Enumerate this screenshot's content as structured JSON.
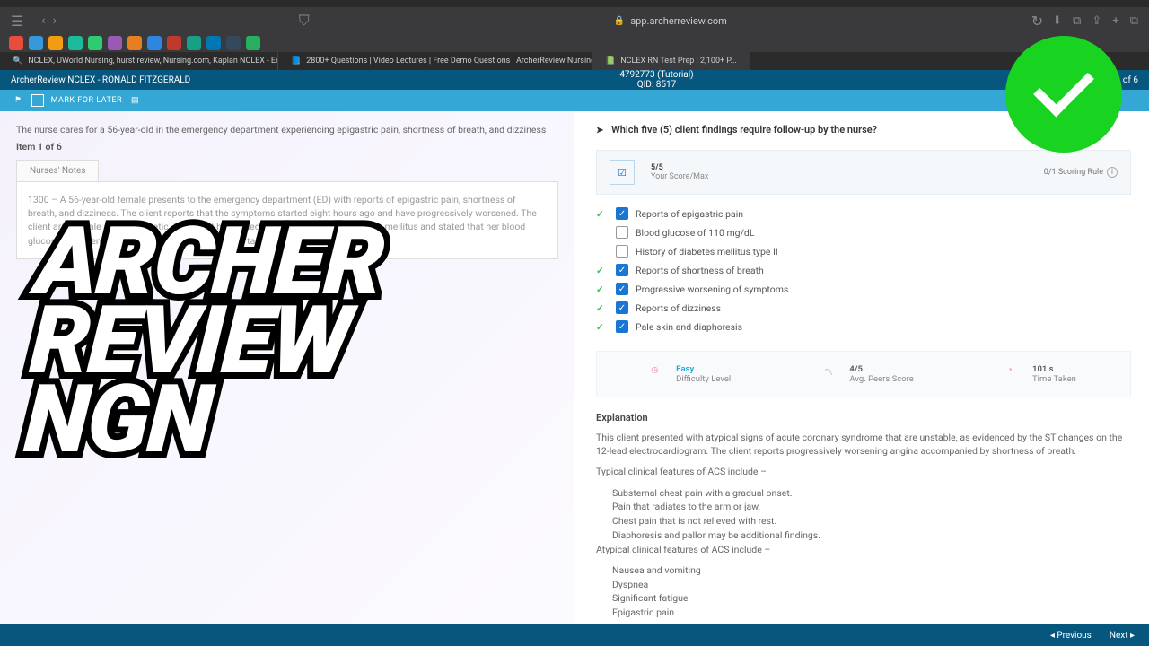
{
  "browser": {
    "url": "app.archerreview.com",
    "tabs": [
      "NCLEX, UWorld Nursing, hurst review, Nursing.com, Kaplan NCLEX - Explore - Go...",
      "2800+ Questions | Video Lectures | Free Demo Questions | ArcherReview Nursing",
      "NCLEX RN Test Prep | 2,100+ P..."
    ]
  },
  "app": {
    "title_left": "ArcherReview NCLEX - RONALD FITZGERALD",
    "title_center_top": "4792773 (Tutorial)",
    "title_center_bottom": "QID: 8517",
    "title_right": "of 6",
    "toolbar_label": "MARK FOR LATER"
  },
  "question": {
    "stem": "The nurse cares for a 56-year-old in the emergency department experiencing epigastric pain, shortness of breath, and dizziness",
    "item_count": "Item 1 of 6",
    "notes_tab": "Nurses' Notes",
    "notes_body": "1300 – A 56-year-old female presents to the emergency department (ED) with reports of epigastric pain, shortness of breath, and dizziness. The client reports that the symptoms started eight hours ago and have progressively worsened. The client arrives pale and diaphoretic. The client has a medical history of type II diabetes mellitus and stated that her blood glucose has been 'very high.' The blood glucose was taken, and it was 110 mg/dL.",
    "prompt": "Which five (5) client findings require follow-up by the nurse?"
  },
  "score": {
    "top": "5/5",
    "bottom": "Your Score/Max",
    "rule": "0/1 Scoring Rule"
  },
  "options": [
    {
      "correct": true,
      "checked": true,
      "label": "Reports of epigastric pain"
    },
    {
      "correct": false,
      "checked": false,
      "label": "Blood glucose of 110 mg/dL"
    },
    {
      "correct": false,
      "checked": false,
      "label": "History of diabetes mellitus type II"
    },
    {
      "correct": true,
      "checked": true,
      "label": "Reports of shortness of breath"
    },
    {
      "correct": true,
      "checked": true,
      "label": "Progressive worsening of symptoms"
    },
    {
      "correct": true,
      "checked": true,
      "label": "Reports of dizziness"
    },
    {
      "correct": true,
      "checked": true,
      "label": "Pale skin and diaphoresis"
    }
  ],
  "stats": {
    "difficulty_value": "Easy",
    "difficulty_label": "Difficulty Level",
    "peers_value": "4/5",
    "peers_label": "Avg. Peers Score",
    "time_value": "101 s",
    "time_label": "Time Taken"
  },
  "explanation": {
    "heading": "Explanation",
    "p1": "This client presented with atypical signs of acute coronary syndrome that are unstable, as evidenced by the ST changes on the 12-lead electrocardiogram. The client reports progressively worsening angina accompanied by shortness of breath.",
    "p2": "Typical clinical features of ACS include –",
    "typical": [
      "Substernal chest pain with a gradual onset.",
      "Pain that radiates to the arm or jaw.",
      "Chest pain that is not relieved with rest.",
      "Diaphoresis and pallor may be additional findings."
    ],
    "p3": "Atypical clinical features of ACS include –",
    "atypical": [
      "Nausea and vomiting",
      "Dyspnea",
      "Significant fatigue",
      "Epigastric pain"
    ]
  },
  "footer": {
    "prev": "Previous",
    "next": "Next"
  },
  "overlay": {
    "l1": "ARCHER",
    "l2": "REVIEW",
    "l3": "NGN"
  }
}
